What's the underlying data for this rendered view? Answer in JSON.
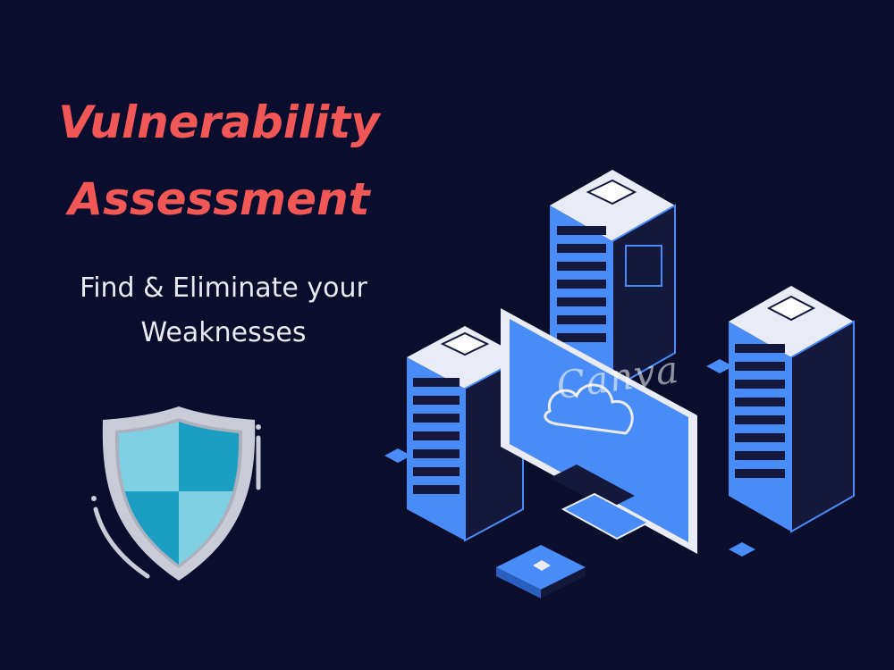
{
  "heading": {
    "line1": "Vulnerability",
    "line2": "Assessment"
  },
  "subheading": {
    "line1": "Find & Eliminate your",
    "line2": "Weaknesses"
  },
  "watermark": "Canva",
  "colors": {
    "background": "#0a0d2b",
    "title": "#f25757",
    "subtitle": "#e9e9f0",
    "accent_blue": "#4a8cf7",
    "shield_teal": "#1a9fc2",
    "shield_light": "#7fd0e4",
    "shield_rim": "#c9ccd6"
  },
  "icons": [
    "shield-icon",
    "server-rack-icon",
    "monitor-icon",
    "cloud-icon",
    "router-icon"
  ]
}
